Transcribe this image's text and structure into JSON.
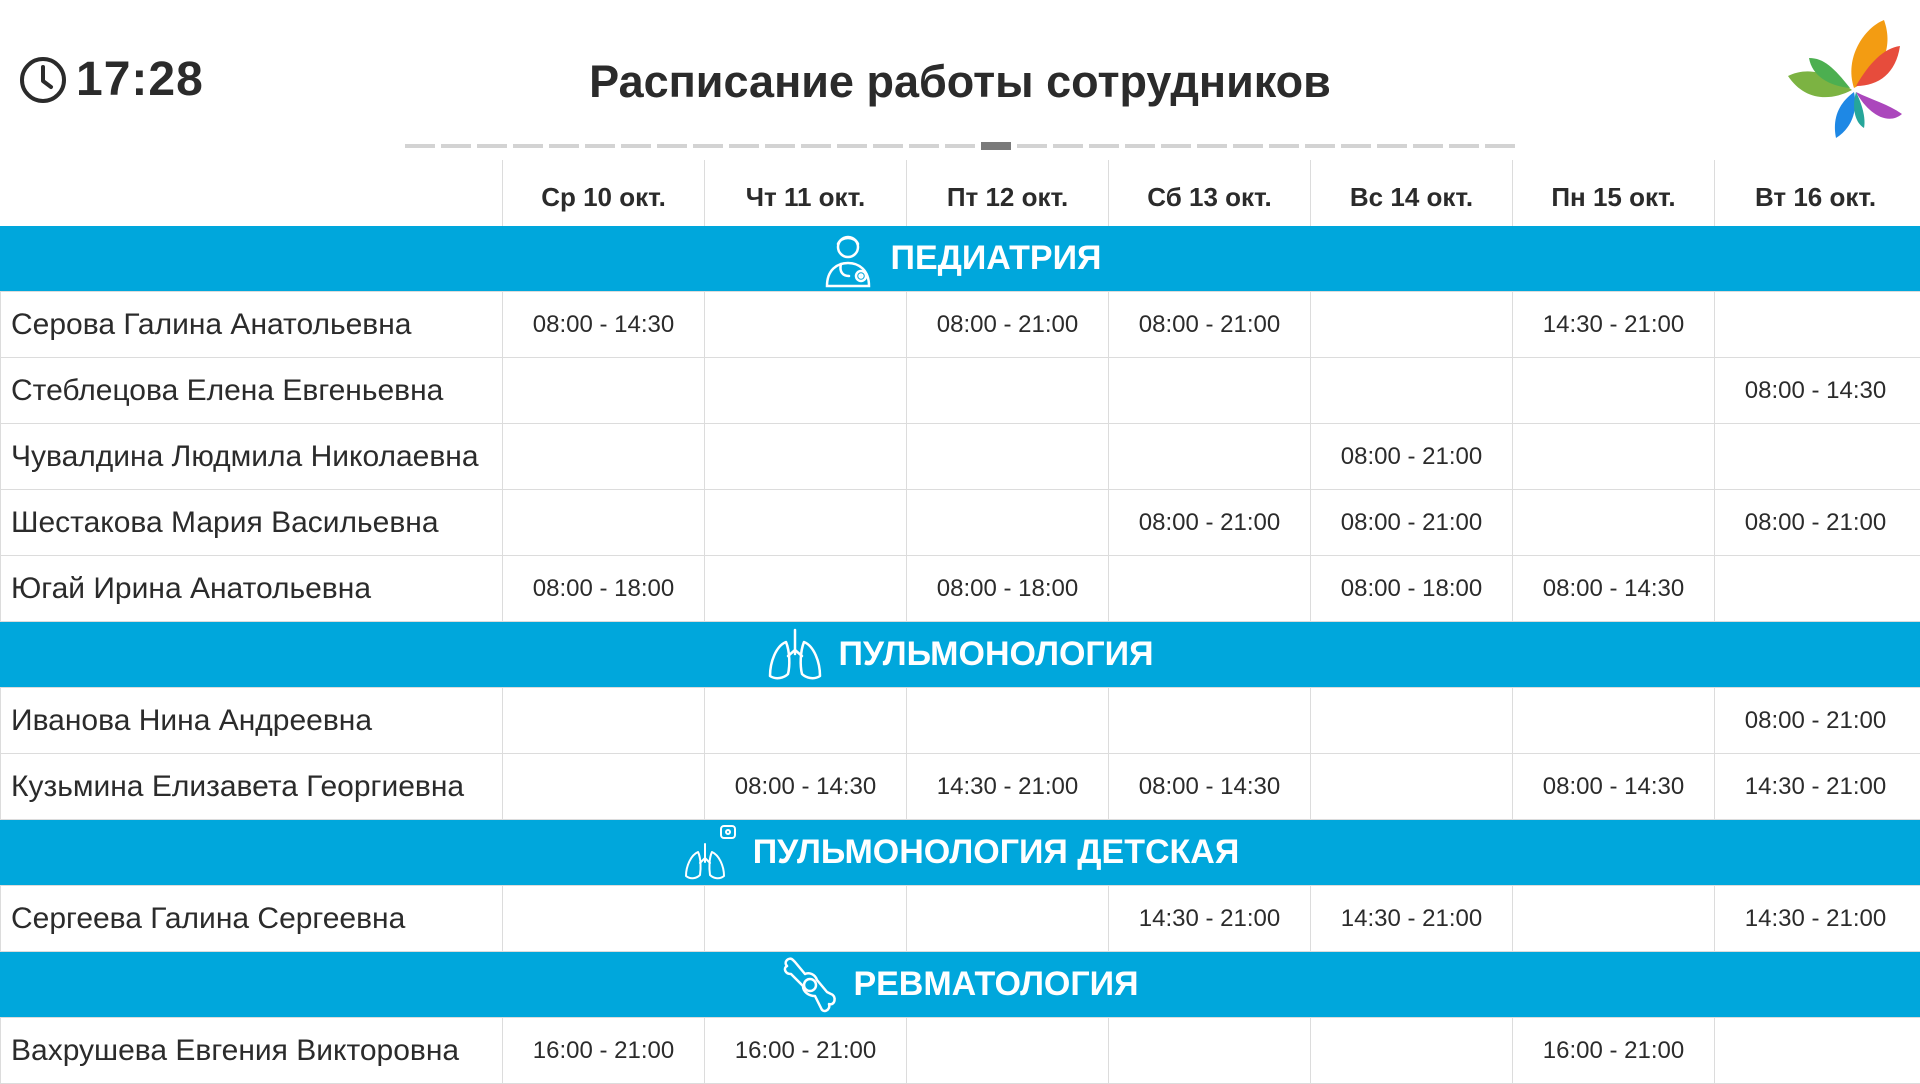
{
  "header": {
    "time": "17:28",
    "title": "Расписание работы сотрудников",
    "clock_icon": "clock-icon",
    "logo_icon": "butterfly-logo-icon"
  },
  "pager": {
    "count": 31,
    "active_index": 16
  },
  "days": [
    "Ср 10 окт.",
    "Чт 11 окт.",
    "Пт 12 окт.",
    "Сб 13 окт.",
    "Вс 14 окт.",
    "Пн 15 окт.",
    "Вт 16 окт."
  ],
  "departments": [
    {
      "name": "ПЕДИАТРИЯ",
      "icon": "pediatrician-icon",
      "staff": [
        {
          "name": "Серова Галина Анатольевна",
          "shifts": [
            "08:00 - 14:30",
            "",
            "08:00 - 21:00",
            "08:00 - 21:00",
            "",
            "14:30 - 21:00",
            ""
          ]
        },
        {
          "name": "Стеблецова Елена Евгеньевна",
          "shifts": [
            "",
            "",
            "",
            "",
            "",
            "",
            "08:00 - 14:30"
          ]
        },
        {
          "name": "Чувалдина Людмила Николаевна",
          "shifts": [
            "",
            "",
            "",
            "",
            "08:00 - 21:00",
            "",
            ""
          ]
        },
        {
          "name": "Шестакова Мария Васильевна",
          "shifts": [
            "",
            "",
            "",
            "08:00 - 21:00",
            "08:00 - 21:00",
            "",
            "08:00 - 21:00"
          ]
        },
        {
          "name": "Югай Ирина Анатольевна",
          "shifts": [
            "08:00 - 18:00",
            "",
            "08:00 - 18:00",
            "",
            "08:00 - 18:00",
            "08:00 - 14:30",
            ""
          ]
        }
      ]
    },
    {
      "name": "ПУЛЬМОНОЛОГИЯ",
      "icon": "lungs-icon",
      "staff": [
        {
          "name": "Иванова Нина Андреевна",
          "shifts": [
            "",
            "",
            "",
            "",
            "",
            "",
            "08:00 - 21:00"
          ]
        },
        {
          "name": "Кузьмина Елизавета Георгиевна",
          "shifts": [
            "",
            "08:00 - 14:30",
            "14:30 - 21:00",
            "08:00 - 14:30",
            "",
            "08:00 - 14:30",
            "14:30 - 21:00"
          ]
        }
      ]
    },
    {
      "name": "ПУЛЬМОНОЛОГИЯ ДЕТСКАЯ",
      "icon": "child-lungs-icon",
      "staff": [
        {
          "name": "Сергеева Галина Сергеевна",
          "shifts": [
            "",
            "",
            "",
            "14:30 - 21:00",
            "14:30 - 21:00",
            "",
            "14:30 - 21:00"
          ]
        }
      ]
    },
    {
      "name": "РЕВМАТОЛОГИЯ",
      "icon": "joint-icon",
      "staff": [
        {
          "name": "Вахрушева Евгения Викторовна",
          "shifts": [
            "16:00 - 21:00",
            "16:00 - 21:00",
            "",
            "",
            "",
            "16:00 - 21:00",
            ""
          ]
        }
      ]
    }
  ]
}
